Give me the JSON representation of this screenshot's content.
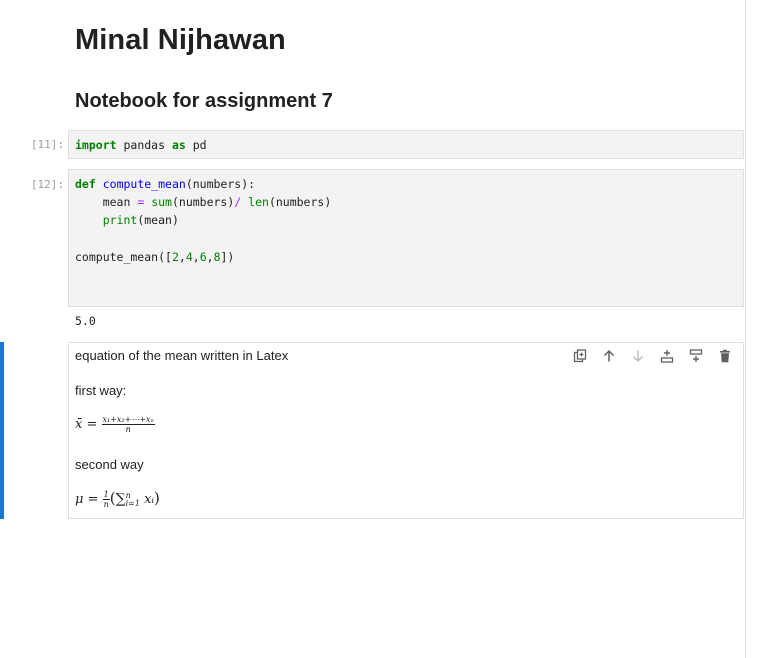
{
  "notebook": {
    "title": "Minal Nijhawan",
    "subtitle": "Notebook for assignment 7"
  },
  "cells": {
    "import_cell": {
      "prompt": "[11]:",
      "tokens": {
        "kw_import": "import",
        "module": " pandas ",
        "kw_as": "as",
        "alias": " pd"
      }
    },
    "func_cell": {
      "prompt": "[12]:",
      "line1": {
        "kw_def": "def",
        "space": " ",
        "fn_name": "compute_mean",
        "args": "(numbers):"
      },
      "line2": {
        "indent": "    mean ",
        "op_eq": "=",
        "sp": " ",
        "bi_sum": "sum",
        "mid": "(numbers)",
        "op_div": "/",
        "sp2": " ",
        "bi_len": "len",
        "tail": "(numbers)"
      },
      "line3": {
        "indent": "    ",
        "bi_print": "print",
        "tail": "(mean)"
      },
      "line5": {
        "call": "compute_mean([",
        "n1": "2",
        "c1": ",",
        "n2": "4",
        "c2": ",",
        "n3": "6",
        "c3": ",",
        "n4": "8",
        "close": "])"
      },
      "output": "5.0"
    },
    "markdown_cell": {
      "line1": "equation of the mean written in Latex",
      "line2": "first way:",
      "line3": "second way",
      "eq1": {
        "lhs": "x̄ =",
        "numerator": "x₁+x₂+⋯+xₙ",
        "denominator": "n"
      },
      "eq2": {
        "lhs": "μ =",
        "frac_num": "1",
        "frac_den": "n",
        "lparen": "(",
        "sum": "∑",
        "sup": "n",
        "sub": "i=1",
        "term": "xᵢ",
        "rparen": ")"
      }
    }
  },
  "toolbar": {
    "icons": [
      "duplicate-icon",
      "move-up-icon",
      "move-down-icon",
      "insert-above-icon",
      "insert-below-icon",
      "delete-icon"
    ]
  },
  "colors": {
    "accent": "#1976d2",
    "keyword": "#008000",
    "function": "#0000ff",
    "operator": "#aa22ff"
  }
}
